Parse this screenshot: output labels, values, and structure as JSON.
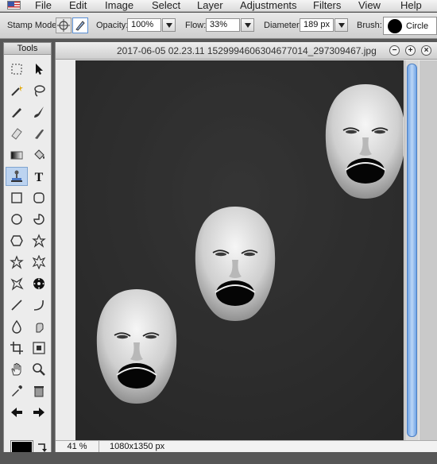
{
  "menubar": {
    "items": [
      "File",
      "Edit",
      "Image",
      "Select",
      "Layer",
      "Adjustments",
      "Filters",
      "View",
      "Help"
    ]
  },
  "options": {
    "stamp_mode_label": "Stamp Mode:",
    "opacity_label": "Opacity:",
    "opacity_value": "100%",
    "flow_label": "Flow:",
    "flow_value": "33%",
    "diameter_label": "Diameter:",
    "diameter_value": "189 px",
    "brush_label": "Brush:",
    "brush_value": "Circle"
  },
  "tools": {
    "title": "Tools",
    "items": [
      "marquee",
      "move",
      "magic-wand",
      "lasso",
      "pencil",
      "brush",
      "eraser",
      "smudge",
      "gradient",
      "bucket",
      "clone-stamp",
      "text",
      "rectangle",
      "rounded-rect",
      "ellipse",
      "pie",
      "hexagon",
      "star",
      "star-outline",
      "burst",
      "splat",
      "flower",
      "line",
      "curve",
      "blur",
      "sharpen",
      "crop",
      "resize",
      "hand",
      "zoom",
      "eyedropper",
      "trash",
      "undo",
      "redo"
    ],
    "selected": "clone-stamp",
    "foreground_color": "#000000"
  },
  "document": {
    "title": "2017-06-05 02.23.11 1529994606304677014_297309467.jpg",
    "zoom": "41 %",
    "dimensions": "1080x1350 px"
  }
}
